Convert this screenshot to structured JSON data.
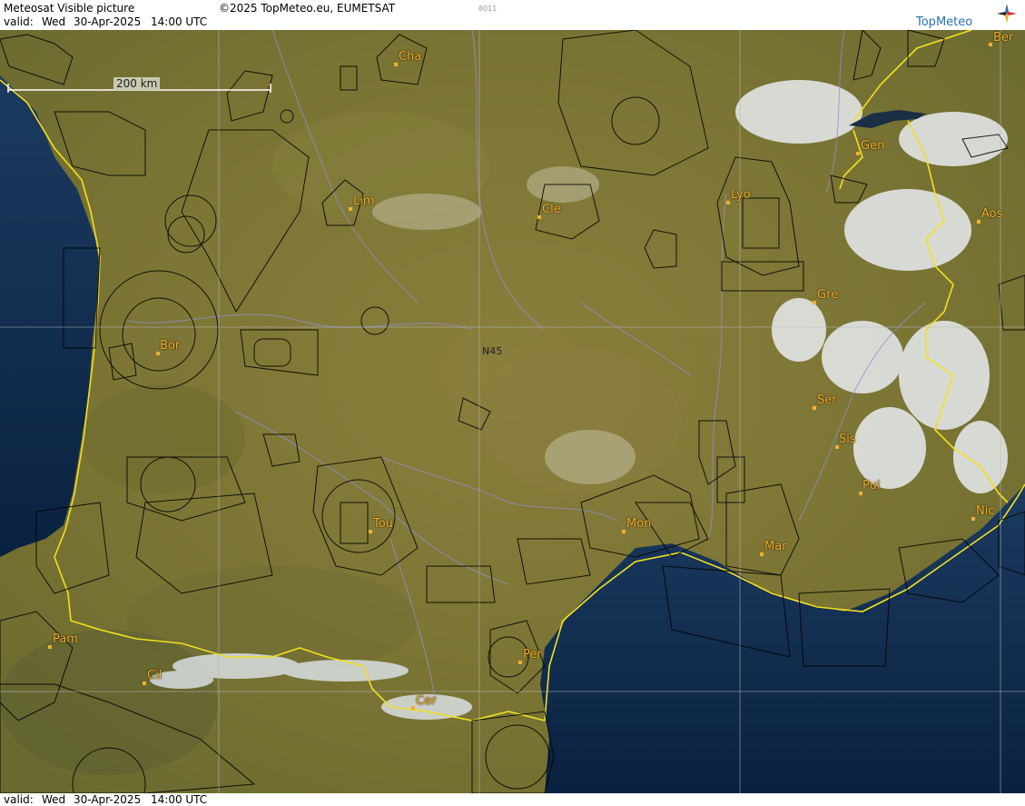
{
  "header": {
    "title": "Meteosat Visible picture",
    "copyright": "©2025 TopMeteo.eu, EUMETSAT",
    "code": "8011",
    "valid_label": "valid:",
    "valid_day": "Wed",
    "valid_date": "30-Apr-2025",
    "valid_time": "14:00 UTC"
  },
  "footer": {
    "valid_label": "valid:",
    "valid_day": "Wed",
    "valid_date": "30-Apr-2025",
    "valid_time": "14:00 UTC"
  },
  "logo": {
    "text": "TopMeteo",
    "icon": "compass-star-icon"
  },
  "scale": {
    "label": "200 km"
  },
  "latitude_label": "N45",
  "cities": [
    {
      "name": "Cha"
    },
    {
      "name": "Lim"
    },
    {
      "name": "Cle"
    },
    {
      "name": "Lyo"
    },
    {
      "name": "Gen"
    },
    {
      "name": "Ber"
    },
    {
      "name": "Aos"
    },
    {
      "name": "Gre"
    },
    {
      "name": "Bor"
    },
    {
      "name": "Ser"
    },
    {
      "name": "Sis"
    },
    {
      "name": "Pui"
    },
    {
      "name": "Tou"
    },
    {
      "name": "Mon"
    },
    {
      "name": "Mar"
    },
    {
      "name": "Nic"
    },
    {
      "name": "Pam"
    },
    {
      "name": "Cil"
    },
    {
      "name": "Per"
    },
    {
      "name": "Cer"
    }
  ],
  "colors": {
    "land": "#7d7a36",
    "sea": "#0f2a4a",
    "border": "#f0e020",
    "snow": "#e8ecf0",
    "airspace": "#000000",
    "river": "#8c8cc8",
    "city": "#f0b030"
  }
}
